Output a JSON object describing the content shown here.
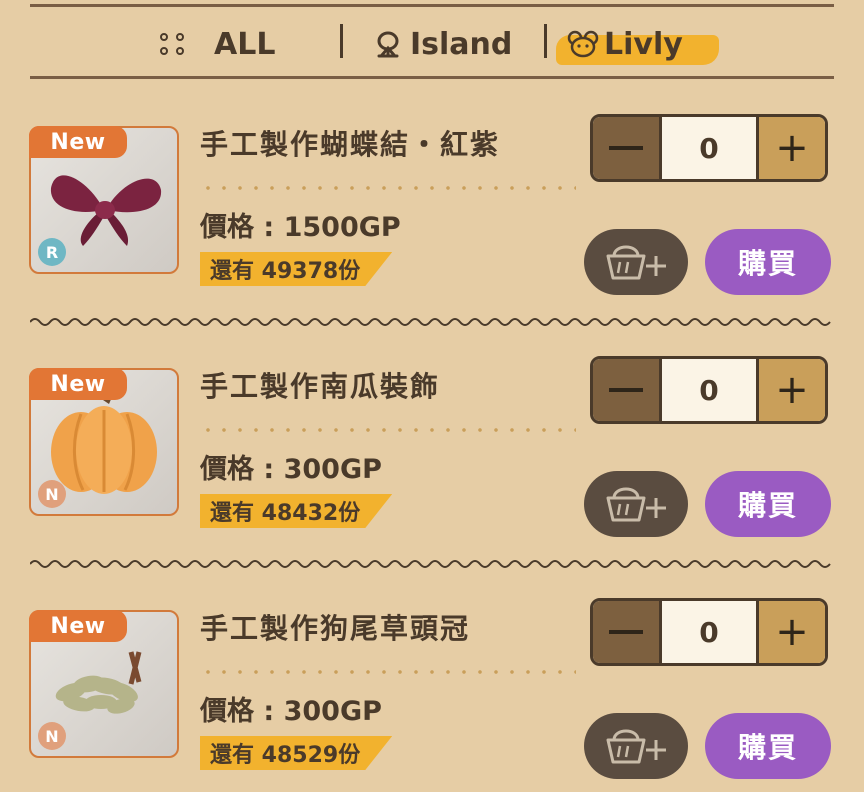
{
  "tabs": [
    {
      "label": "ALL",
      "icon": "four-dots-icon"
    },
    {
      "label": "Island",
      "icon": "island-icon"
    },
    {
      "label": "Livly",
      "icon": "livly-face-icon",
      "active": true
    }
  ],
  "colors": {
    "background": "#e6cda5",
    "accent": "#f2b22e",
    "new_badge": "#e27635",
    "buy_button": "#9a5bc2",
    "cart_button": "#5a4c40",
    "rarity_r": "#6fb7c4",
    "rarity_n": "#e0a07c"
  },
  "items": [
    {
      "badge": "New",
      "rarity": "R",
      "name": "手工製作蝴蝶結・紅紫",
      "price": "價格 : 1500GP",
      "stock": "還有 49378份",
      "quantity": "0",
      "buy_label": "購買",
      "image": "bow-icon"
    },
    {
      "badge": "New",
      "rarity": "N",
      "name": "手工製作南瓜裝飾",
      "price": "價格 : 300GP",
      "stock": "還有 48432份",
      "quantity": "0",
      "buy_label": "購買",
      "image": "pumpkin-icon"
    },
    {
      "badge": "New",
      "rarity": "N",
      "name": "手工製作狗尾草頭冠",
      "price": "價格 : 300GP",
      "stock": "還有 48529份",
      "quantity": "0",
      "buy_label": "購買",
      "image": "foxtail-crown-icon"
    }
  ]
}
